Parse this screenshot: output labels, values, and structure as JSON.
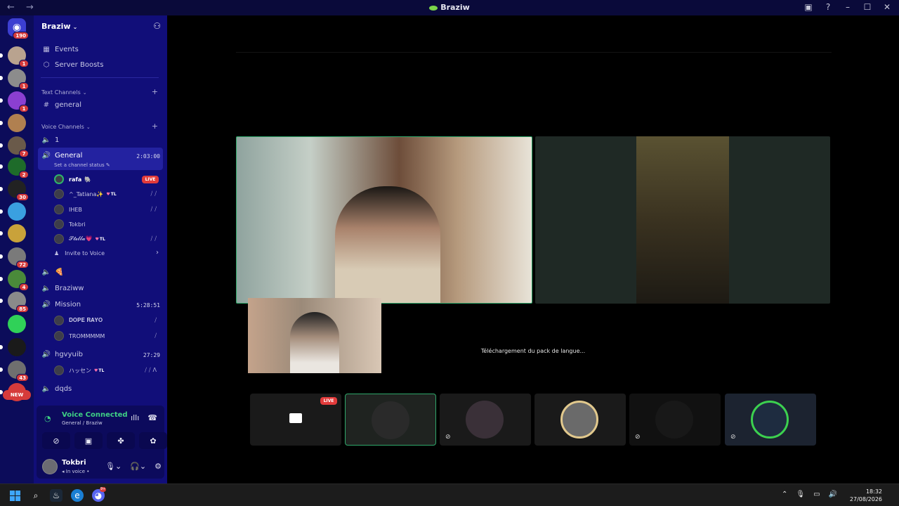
{
  "window": {
    "title": "Braziw",
    "nav_arrows": "← →"
  },
  "rail": {
    "home_badge": "190",
    "servers": [
      {
        "badge": "1",
        "color": "#b9a38f"
      },
      {
        "badge": "1",
        "color": "#8c8c8c"
      },
      {
        "badge": "1",
        "color": "#8b3fd1"
      },
      {
        "badge": "",
        "color": "#b08050"
      },
      {
        "badge": "7",
        "color": "#6a5a4a"
      },
      {
        "badge": "2",
        "color": "#1e6b2a"
      },
      {
        "badge": "30",
        "color": "#222222"
      },
      {
        "badge": "",
        "color": "#3aa0e0"
      },
      {
        "badge": "",
        "color": "#c9a23a"
      },
      {
        "badge": "72",
        "color": "#7a7a7a"
      },
      {
        "badge": "4",
        "color": "#4a8a3a"
      },
      {
        "badge": "85",
        "color": "#8a8a8a"
      },
      {
        "badge": "",
        "color": "#30d158"
      },
      {
        "badge": "",
        "color": "#1a1a1a"
      },
      {
        "badge": "43",
        "color": "#6f6f6f"
      },
      {
        "badge": "",
        "color": "#d63b3b"
      }
    ],
    "new_label": "NEW"
  },
  "panel": {
    "server_name": "Braziw",
    "events": "Events",
    "server_boosts": "Server Boosts",
    "text_channels_label": "Text Channels",
    "text_channels": [
      "general"
    ],
    "voice_channels_label": "Voice Channels",
    "voice": {
      "ch1": "1",
      "general": "General",
      "general_time": "2:03:00",
      "set_status": "Set a channel status",
      "general_users": [
        {
          "name": "rafa",
          "emoji": "🐘",
          "live": "LIVE"
        },
        {
          "name": "^_Tatiana✨",
          "tl": "TL"
        },
        {
          "name": "IHEB"
        },
        {
          "name": "Tokbri"
        },
        {
          "name": "𝓢𝓽𝓮𝓵𝓵𝓪💗",
          "tl": "TL"
        }
      ],
      "invite": "Invite to Voice",
      "pizza": "🍕",
      "braziww": "Braziww",
      "mission": "Mission",
      "mission_time": "5:28:51",
      "mission_users": [
        {
          "name": "𝐃𝐎𝐏𝐄 𝐑𝐀𝐘𝐎"
        },
        {
          "name": "TROMMMMM"
        }
      ],
      "hgvyuib": "hgvyuib",
      "hgvyuib_time": "27:29",
      "hgvyuib_users": [
        {
          "name": "ハッセン",
          "tl": "TL"
        }
      ],
      "dqds": "dqds"
    }
  },
  "voice_panel": {
    "title": "Voice Connected",
    "subtitle": "General / Braziw"
  },
  "user": {
    "name": "Tokbri",
    "status": "In voice"
  },
  "main": {
    "language_message": "Téléchargement du pack de langue...",
    "live_label": "LIVE"
  },
  "taskbar": {
    "time": "18:32",
    "date": "27/08/2026",
    "discord_badge": "9+"
  }
}
